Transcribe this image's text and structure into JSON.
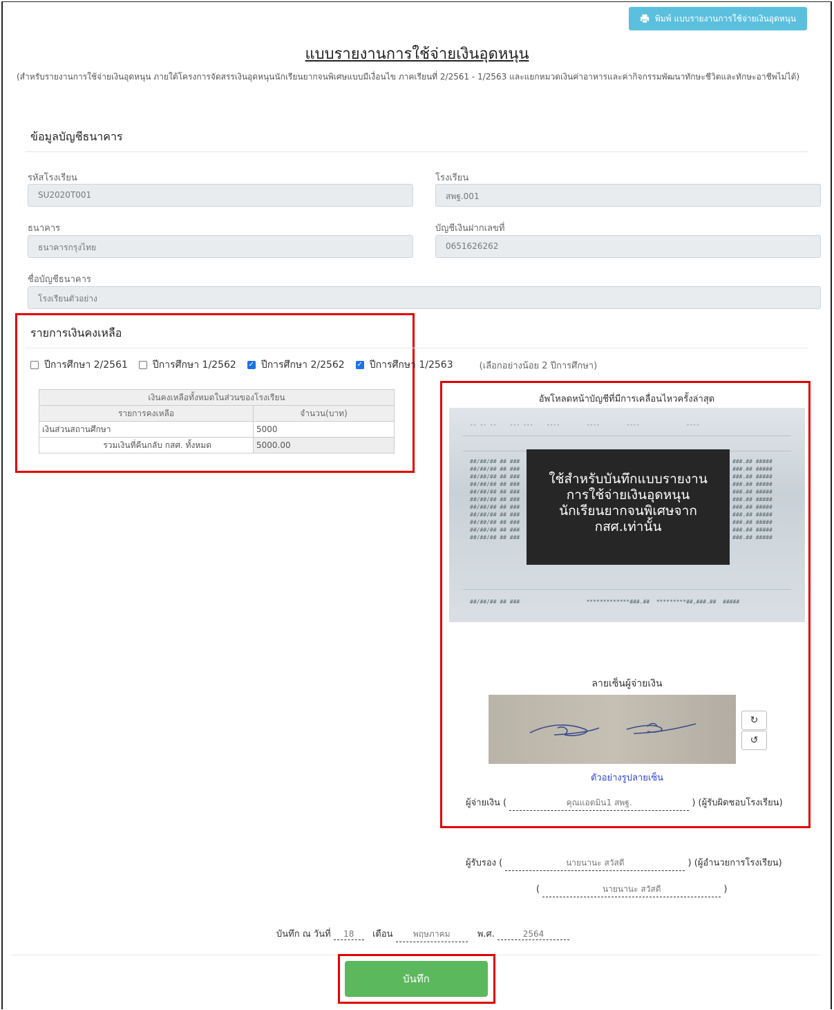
{
  "print_button": {
    "label": "พิมพ์ แบบรายงานการใช้จ่ายเงินอุดหนุน",
    "icon": "printer-icon"
  },
  "title": "แบบรายงานการใช้จ่ายเงินอุดหนุน",
  "description": "(สำหรับรายงานการใช้จ่ายเงินอุดหนุน ภายใต้โครงการจัดสรรเงินอุดหนุนนักเรียนยากจนพิเศษแบบมีเงื่อนไข ภาคเรียนที่ 2/2561 - 1/2563 และแยกหมวดเงินค่าอาหารและค่ากิจกรรมพัฒนาทักษะชีวิตและทักษะอาชีพไม่ได้)",
  "bank_section": {
    "heading": "ข้อมูลบัญชีธนาคาร",
    "school_code_label": "รหัสโรงเรียน",
    "school_code_value": "SU2020T001",
    "school_label": "โรงเรียน",
    "school_value": "สพฐ.001",
    "bank_label": "ธนาคาร",
    "bank_value": "ธนาคารกรุงไทย",
    "account_no_label": "บัญชีเงินฝากเลขที่",
    "account_no_value": "0651626262",
    "account_name_label": "ชื่อบัญชีธนาคาร",
    "account_name_value": "โรงเรียนตัวอย่าง"
  },
  "balance_section": {
    "heading": "รายการเงินคงเหลือ",
    "years": [
      {
        "label": "ปีการศึกษา 2/2561",
        "checked": false
      },
      {
        "label": "ปีการศึกษา 1/2562",
        "checked": false
      },
      {
        "label": "ปีการศึกษา 2/2562",
        "checked": true
      },
      {
        "label": "ปีการศึกษา 1/2563",
        "checked": true
      }
    ],
    "hint": "(เลือกอย่างน้อย 2 ปีการศึกษา)",
    "table": {
      "caption": "เงินคงเหลือทั้งหมดในส่วนของโรงเรียน",
      "col_item": "รายการคงเหลือ",
      "col_amount": "จำนวน(บาท)",
      "row1_item": "เงินส่วนสถานศึกษา",
      "row1_amount": "5000",
      "total_item": "รวมเงินที่คืนกลับ กสศ. ทั้งหมด",
      "total_amount": "5000.00"
    }
  },
  "upload": {
    "title": "อัพโหลดหน้าบัญชีที่มีการเคลื่อนไหวครั้งล่าสุด",
    "watermark": [
      "ใช้สำหรับบันทึกแบบรายงาน",
      "การใช้จ่ายเงินอุดหนุน",
      "นักเรียนยากจนพิเศษจาก",
      "กสศ.เท่านั้น"
    ]
  },
  "signature": {
    "label": "ลายเซ็นผู้จ่ายเงิน",
    "sample_link": "ตัวอย่างรูปลายเซ็น",
    "payer_prefix": "ผู้จ่ายเงิน (",
    "payer_name": "คุณแอดมิน1 สพฐ.",
    "payer_suffix": ") (ผู้รับผิดชอบโรงเรียน)"
  },
  "certifier": {
    "prefix": "ผู้รับรอง (",
    "name": "นายนานะ สวัสดี",
    "suffix": ") (ผู้อำนวยการโรงเรียน)",
    "name2_open": "(",
    "name2": "นายนานะ สวัสดี",
    "name2_close": ")"
  },
  "record_date": {
    "prefix": "บันทึก ณ วันที่",
    "day": "18",
    "month_label": "เดือน",
    "month": "พฤษภาคม",
    "year_label": "พ.ศ.",
    "year": "2564"
  },
  "save_button": {
    "label": "บันทึก"
  }
}
